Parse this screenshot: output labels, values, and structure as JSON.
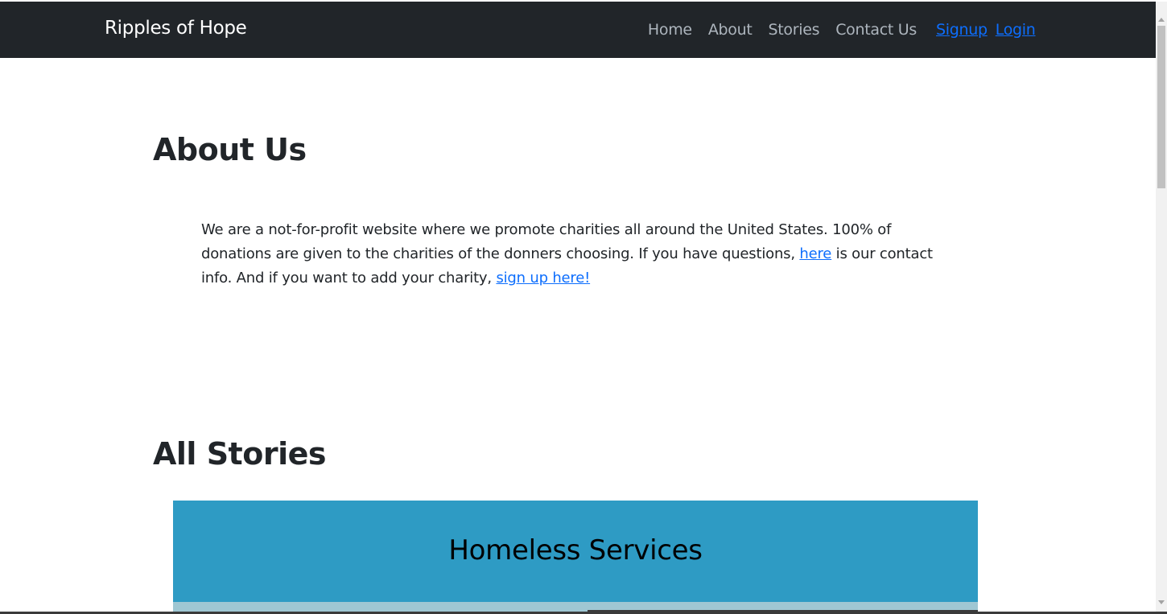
{
  "navbar": {
    "brand": "Ripples of Hope",
    "links": [
      "Home",
      "About",
      "Stories",
      "Contact Us"
    ],
    "auth": {
      "signup": "Signup",
      "login": "Login"
    }
  },
  "about": {
    "heading": "About Us",
    "text_part1": "We are a not-for-profit website where we promote charities all around the United States. 100% of donations are given to the charities of the donners choosing. If you have questions, ",
    "link_here": "here",
    "text_part2": " is our contact info. And if you want to add your charity, ",
    "link_signup": "sign up here!"
  },
  "stories": {
    "heading": "All Stories",
    "cards": [
      {
        "title": "Homeless Services"
      }
    ]
  },
  "colors": {
    "navbar_bg": "#212529",
    "link": "#0d6efd",
    "card_bg": "#2e9bc4"
  }
}
